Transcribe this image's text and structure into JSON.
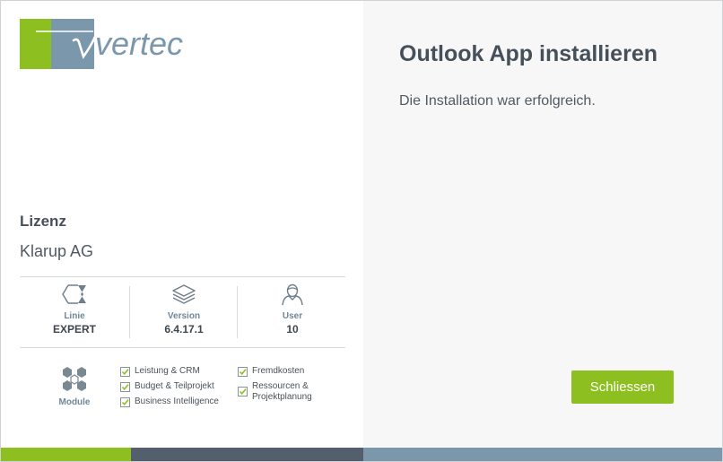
{
  "brand": {
    "logo_text": "vertec",
    "green": "#8cbf1f",
    "blue": "#7b97ab",
    "dark": "#535f6c"
  },
  "license": {
    "title": "Lizenz",
    "company": "Klarup AG",
    "stats": [
      {
        "icon": "edition-icon",
        "label": "Linie",
        "value": "EXPERT"
      },
      {
        "icon": "layers-icon",
        "label": "Version",
        "value": "6.4.17.1"
      },
      {
        "icon": "user-icon",
        "label": "User",
        "value": "10"
      }
    ],
    "modules_label": "Module",
    "modules_icon": "hexagon-cluster-icon",
    "modules": [
      {
        "label": "Leistung & CRM",
        "checked": true
      },
      {
        "label": "Budget & Teilprojekt",
        "checked": true
      },
      {
        "label": "Business Intelligence",
        "checked": true
      },
      {
        "label": "Fremdkosten",
        "checked": true
      },
      {
        "label": "Ressourcen & Projektplanung",
        "checked": true
      }
    ]
  },
  "dialog": {
    "title": "Outlook App installieren",
    "message": "Die Installation war erfolgreich.",
    "close_label": "Schliessen"
  }
}
